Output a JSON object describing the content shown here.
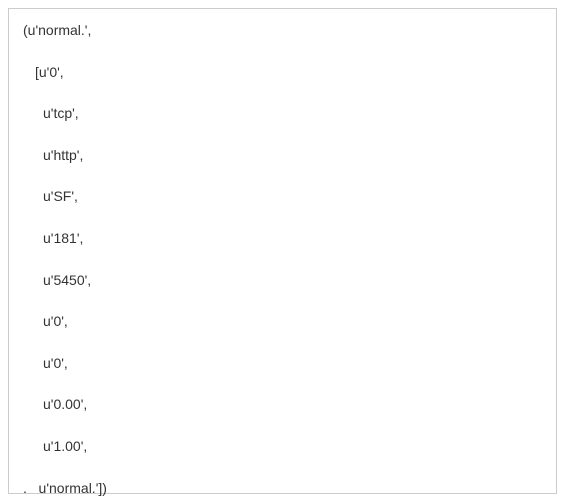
{
  "output": {
    "line1": "(u'normal.',",
    "line2": "[u'0',",
    "line3": "u'tcp',",
    "line4": "u'http',",
    "line5": "u'SF',",
    "line6": "u'181',",
    "line7": "u'5450',",
    "line8": "u'0',",
    "line9": "u'0',",
    "line10": "u'0.00',",
    "line11": "u'1.00',",
    "line12": ".   u'normal.'])"
  }
}
